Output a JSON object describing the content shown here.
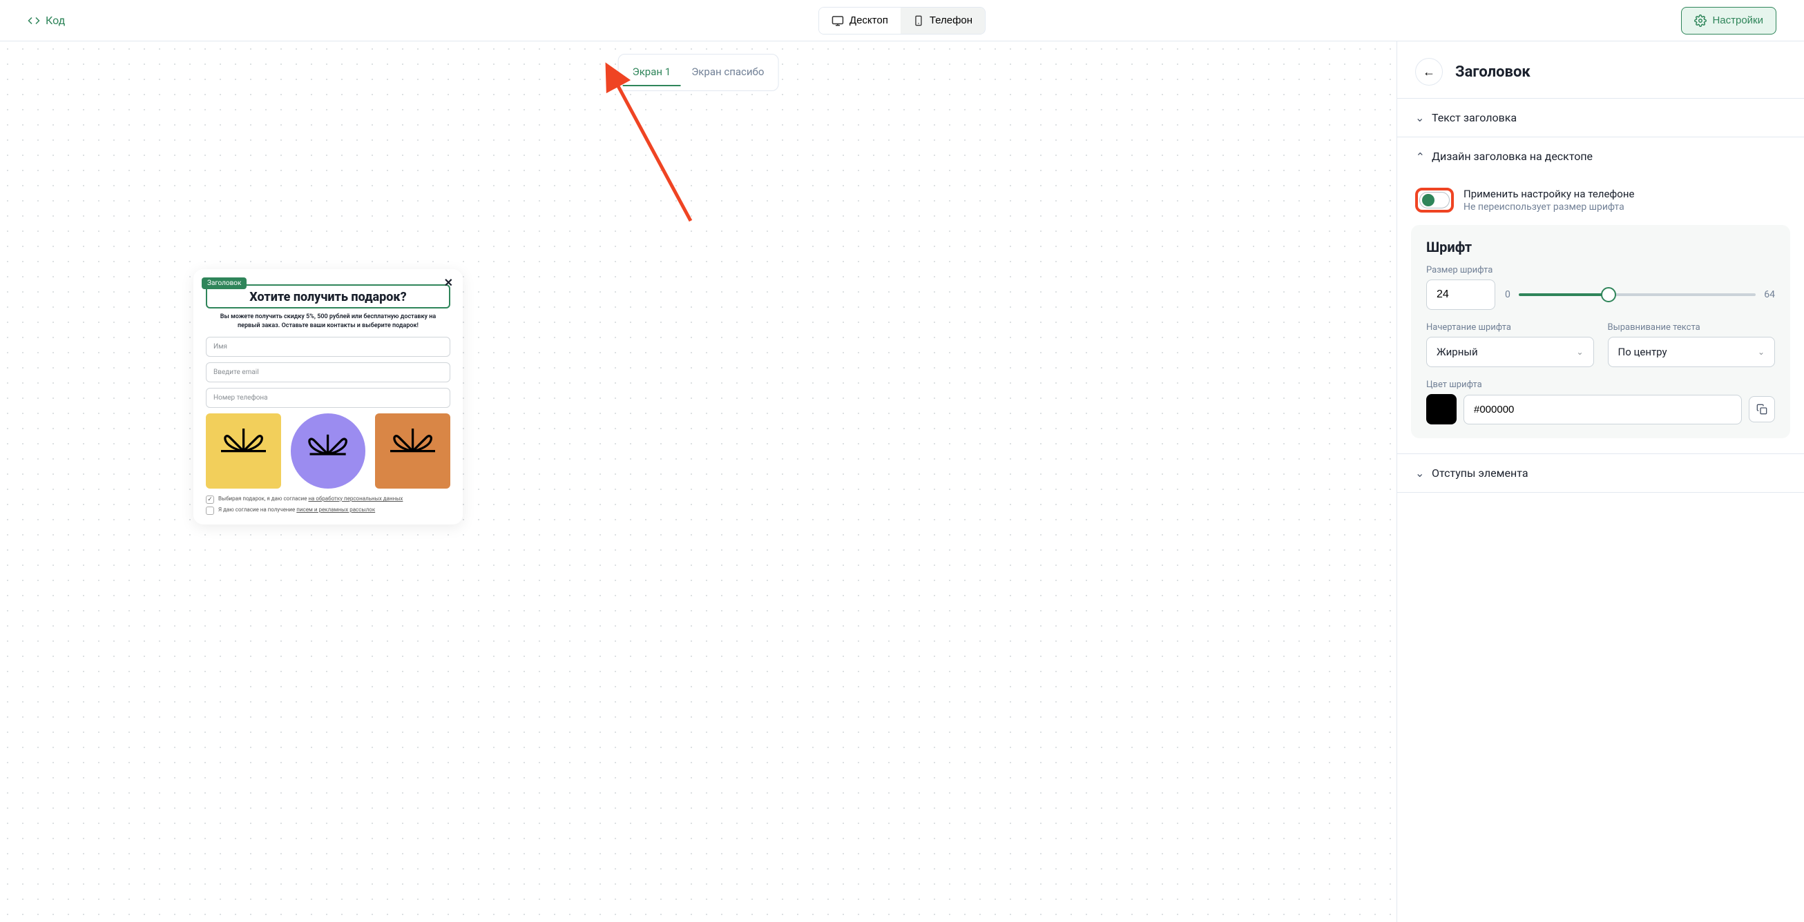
{
  "topbar": {
    "code": "Код",
    "desktop": "Десктоп",
    "phone": "Телефон",
    "settings": "Настройки"
  },
  "screen_tabs": {
    "active": "Экран 1",
    "thanks": "Экран спасибо"
  },
  "popup": {
    "badge": "Заголовок",
    "title": "Хотите получить подарок?",
    "subtitle": "Вы можете получить скидку 5%, 500 рублей или бесплатную доставку на первый заказ. Оставьте ваши контакты и выберите подарок!",
    "placeholders": {
      "name": "Имя",
      "email": "Введите email",
      "phone": "Номер телефона"
    },
    "consent1_prefix": "Выбирая подарок, я даю согласие ",
    "consent1_link": "на обработку персональных данных",
    "consent2_prefix": "Я даю согласие на получение ",
    "consent2_link": "писем и рекламных рассылок"
  },
  "panel": {
    "title": "Заголовок",
    "acc_text": "Текст заголовка",
    "acc_design": "Дизайн заголовка на десктопе",
    "toggle_title": "Применить настройку на телефоне",
    "toggle_sub": "Не переиспользует размер шрифта",
    "font_section_title": "Шрифт",
    "size_label": "Размер шрифта",
    "size_value": "24",
    "size_min": "0",
    "size_max": "64",
    "weight_label": "Начертание шрифта",
    "weight_value": "Жирный",
    "align_label": "Выравнивание текста",
    "align_value": "По центру",
    "color_label": "Цвет шрифта",
    "color_value": "#000000",
    "acc_margins": "Отступы элемента"
  }
}
